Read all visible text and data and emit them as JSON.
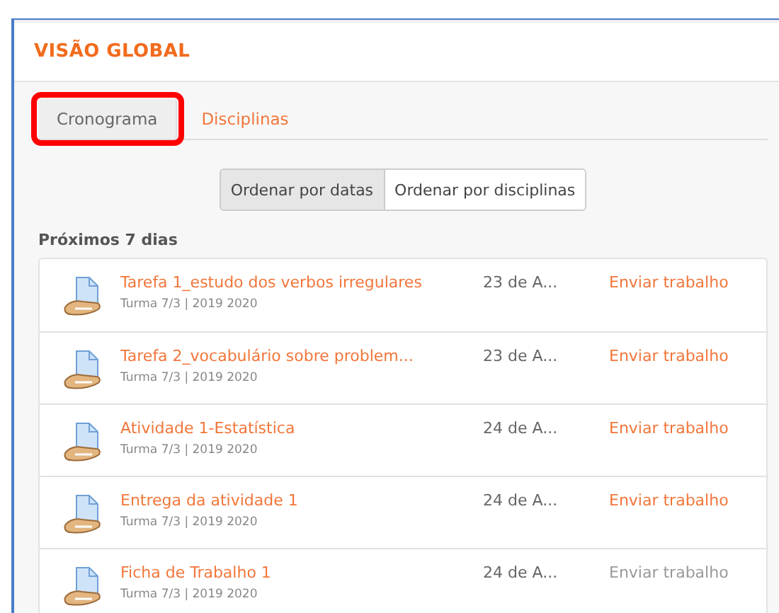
{
  "block": {
    "title": "VISÃO GLOBAL"
  },
  "tabs": [
    {
      "label": "Cronograma",
      "selected": true,
      "highlighted": true
    },
    {
      "label": "Disciplinas",
      "selected": false,
      "highlighted": false
    }
  ],
  "sort_buttons": [
    {
      "label": "Ordenar por datas",
      "selected": true
    },
    {
      "label": "Ordenar por disciplinas",
      "selected": false
    }
  ],
  "section_title": "Próximos 7 dias",
  "events": [
    {
      "title": "Tarefa 1_estudo dos verbos irregulares",
      "course": "Turma 7/3 | 2019 2020",
      "date": "23 de A...",
      "action": "Enviar trabalho",
      "action_disabled": false
    },
    {
      "title": "Tarefa 2_vocabulário sobre problem...",
      "course": "Turma 7/3 | 2019 2020",
      "date": "23 de A...",
      "action": "Enviar trabalho",
      "action_disabled": false
    },
    {
      "title": "Atividade 1-Estatística",
      "course": "Turma 7/3 | 2019 2020",
      "date": "24 de A...",
      "action": "Enviar trabalho",
      "action_disabled": false
    },
    {
      "title": "Entrega da atividade 1",
      "course": "Turma 7/3 | 2019 2020",
      "date": "24 de A...",
      "action": "Enviar trabalho",
      "action_disabled": false
    },
    {
      "title": "Ficha de Trabalho 1",
      "course": "Turma 7/3 | 2019 2020",
      "date": "24 de A...",
      "action": "Enviar trabalho",
      "action_disabled": true
    }
  ]
}
